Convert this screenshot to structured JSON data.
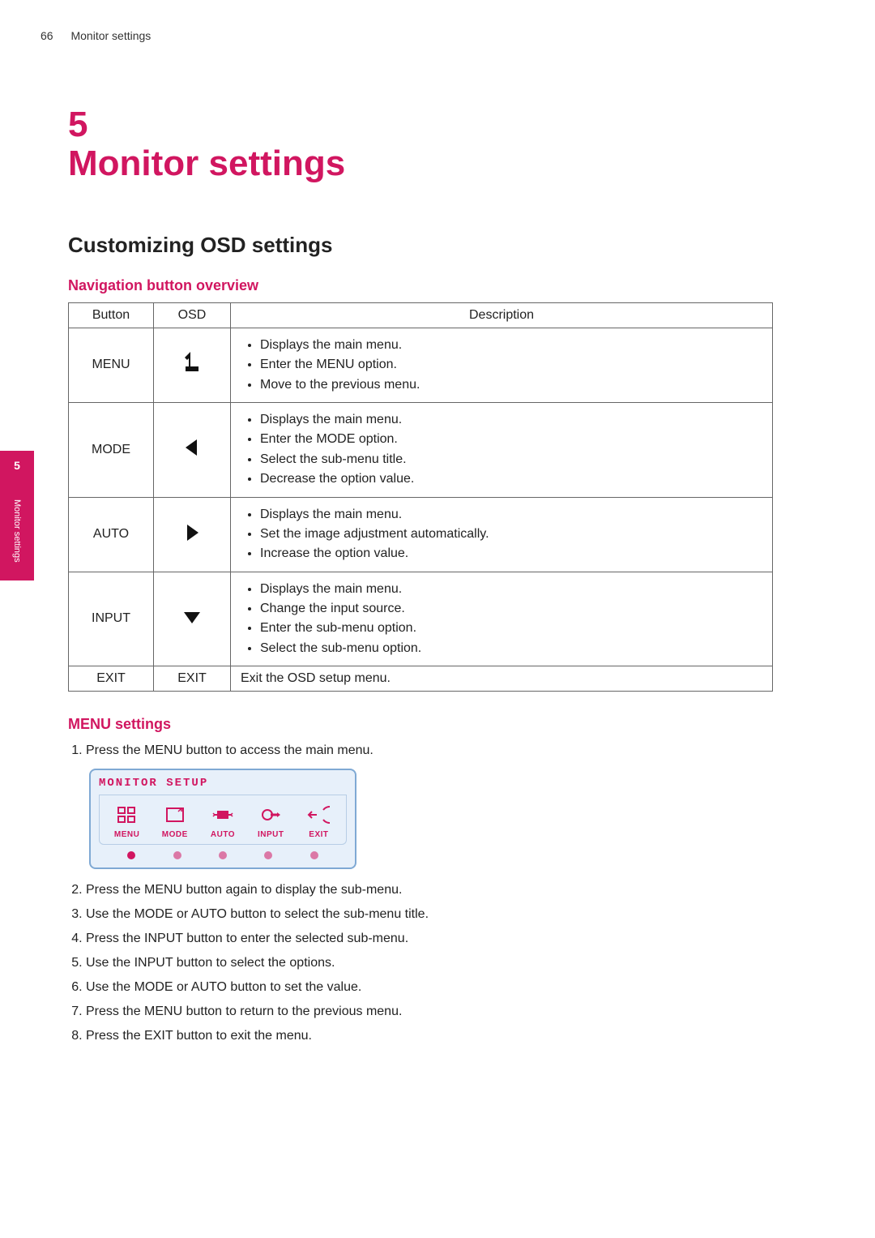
{
  "header": {
    "page_number": "66",
    "running_title": "Monitor settings"
  },
  "side_tab": {
    "number": "5",
    "label": "Monitor settings"
  },
  "chapter": {
    "number": "5",
    "title": "Monitor settings"
  },
  "section": {
    "title": "Customizing OSD settings"
  },
  "nav_table": {
    "heading": "Navigation button overview",
    "columns": {
      "button": "Button",
      "osd": "OSD",
      "description": "Description"
    },
    "rows": [
      {
        "button": "MENU",
        "osd_icon": "menu-glyph-icon",
        "desc": [
          "Displays the main menu.",
          "Enter the MENU option.",
          "Move to the previous menu."
        ]
      },
      {
        "button": "MODE",
        "osd_icon": "triangle-left-icon",
        "desc": [
          "Displays the main menu.",
          "Enter the MODE option.",
          "Select the sub-menu title.",
          "Decrease the option value."
        ]
      },
      {
        "button": "AUTO",
        "osd_icon": "triangle-right-icon",
        "desc": [
          "Displays the main menu.",
          "Set the image adjustment automatically.",
          "Increase the option value."
        ]
      },
      {
        "button": "INPUT",
        "osd_icon": "triangle-down-icon",
        "desc": [
          "Displays the main menu.",
          "Change the input source.",
          "Enter the sub-menu option.",
          "Select the sub-menu option."
        ]
      },
      {
        "button": "EXIT",
        "osd_text": "EXIT",
        "desc_single": "Exit the OSD setup menu."
      }
    ]
  },
  "menu_settings": {
    "heading": "MENU settings",
    "steps": [
      "Press the MENU button to access the main menu.",
      "Press the MENU button again to display the sub-menu.",
      "Use the MODE or AUTO button to select the sub-menu title.",
      "Press the INPUT button to enter the selected sub-menu.",
      "Use the INPUT button to select the options.",
      "Use the MODE or AUTO button to set the value.",
      "Press the MENU button to return to the previous menu.",
      "Press the EXIT button to exit the menu."
    ],
    "osd_figure": {
      "title": "MONITOR SETUP",
      "items": [
        {
          "label": "MENU",
          "icon": "menu-grid-icon",
          "selected": true
        },
        {
          "label": "MODE",
          "icon": "mode-frame-icon",
          "selected": false
        },
        {
          "label": "AUTO",
          "icon": "auto-adjust-icon",
          "selected": false
        },
        {
          "label": "INPUT",
          "icon": "input-plug-icon",
          "selected": false
        },
        {
          "label": "EXIT",
          "icon": "exit-arrow-icon",
          "selected": false
        }
      ]
    }
  }
}
